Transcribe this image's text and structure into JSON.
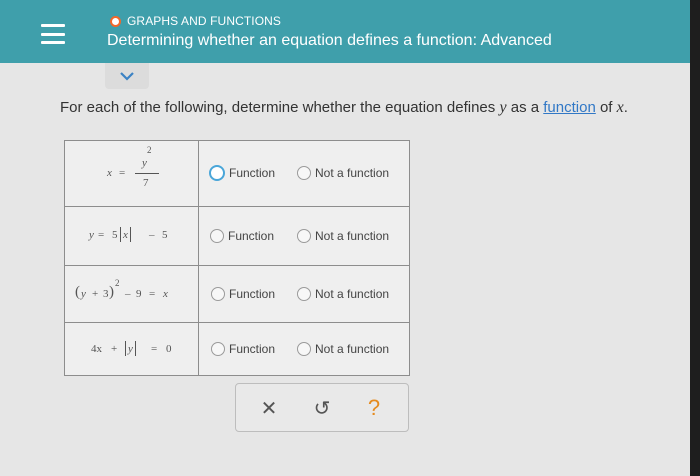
{
  "header": {
    "category": "GRAPHS AND FUNCTIONS",
    "title": "Determining whether an equation defines a function: Advanced"
  },
  "question": {
    "prefix": "For each of the following, determine whether the equation defines ",
    "var_y": "y",
    "middle": " as a ",
    "link_text": "function",
    "middle2": " of ",
    "var_x": "x",
    "suffix": "."
  },
  "options": {
    "function_label": "Function",
    "not_function_label": "Not a function"
  },
  "equations": {
    "e1": {
      "x": "x",
      "eq": "=",
      "num_base": "y",
      "num_exp": "2",
      "den": "7"
    },
    "e2": {
      "y": "y",
      "eq": "=",
      "coef": "5",
      "abs_var": "x",
      "minus": "–",
      "const": "5"
    },
    "e3": {
      "lp": "(",
      "y": "y",
      "plus": "+",
      "three": "3",
      "rp": ")",
      "exp": "2",
      "minus": "–",
      "nine": "9",
      "eq": "=",
      "x": "x"
    },
    "e4": {
      "coef": "4x",
      "plus": "+",
      "abs_var": "y",
      "eq": "=",
      "zero": "0"
    }
  },
  "toolbar": {
    "clear": "✕",
    "undo": "↺",
    "help": "?"
  },
  "colors": {
    "header": "#3f9fab",
    "category_dot": "#f2672a",
    "link": "#3178c6",
    "help": "#e58b1f"
  }
}
